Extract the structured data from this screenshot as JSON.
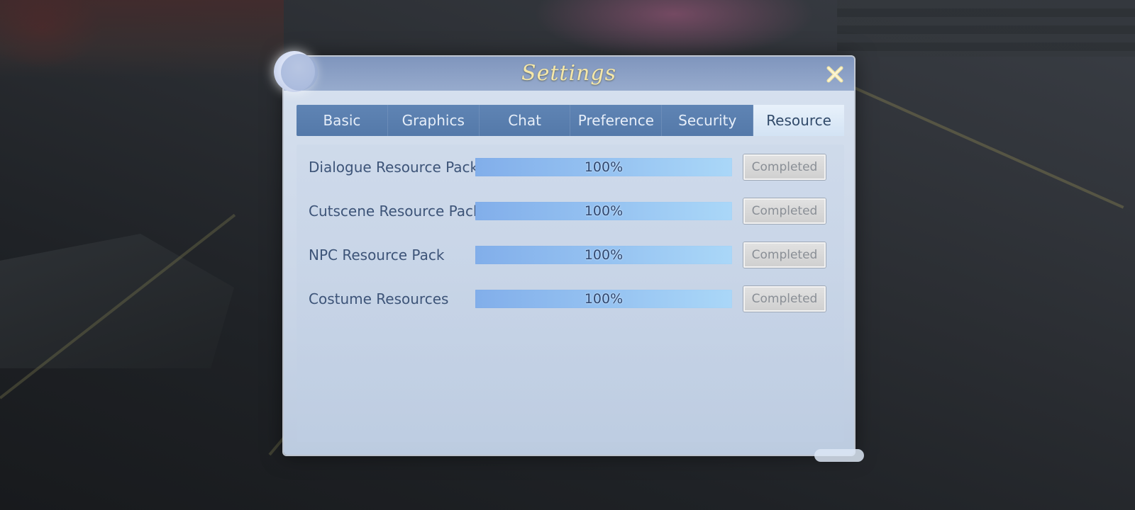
{
  "dialog": {
    "title": "Settings"
  },
  "tabs": [
    {
      "label": "Basic",
      "active": false
    },
    {
      "label": "Graphics",
      "active": false
    },
    {
      "label": "Chat",
      "active": false
    },
    {
      "label": "Preference",
      "active": false
    },
    {
      "label": "Security",
      "active": false
    },
    {
      "label": "Resource",
      "active": true
    }
  ],
  "resources": [
    {
      "label": "Dialogue Resource Pack",
      "progress_text": "100%",
      "progress": 1.0,
      "status": "Completed"
    },
    {
      "label": "Cutscene Resource Pack",
      "progress_text": "100%",
      "progress": 1.0,
      "status": "Completed"
    },
    {
      "label": "NPC Resource Pack",
      "progress_text": "100%",
      "progress": 1.0,
      "status": "Completed"
    },
    {
      "label": "Costume Resources",
      "progress_text": "100%",
      "progress": 1.0,
      "status": "Completed"
    }
  ],
  "colors": {
    "title": "#f5e7a8",
    "tab_bar": "#5479a9",
    "tab_active": "#e8f1fb",
    "progress": "#86b2eb",
    "label": "#3d5478"
  },
  "icons": {
    "close": "close-icon",
    "moon": "moon-icon"
  }
}
